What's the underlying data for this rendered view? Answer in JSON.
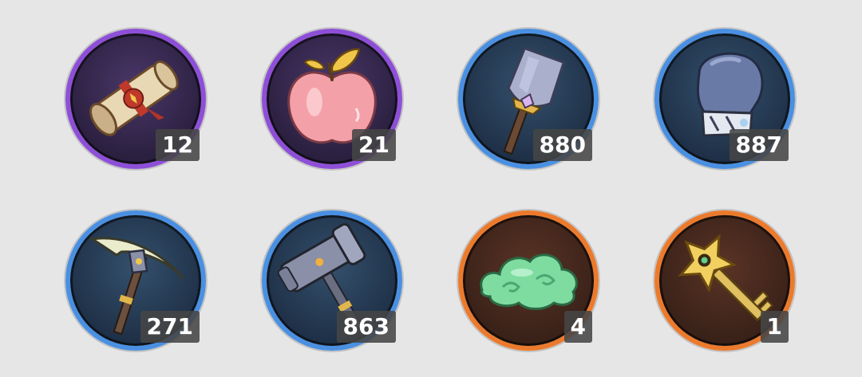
{
  "inventory": {
    "items": [
      {
        "icon": "scroll-icon",
        "rarity": "purple",
        "count": "12"
      },
      {
        "icon": "apple-icon",
        "rarity": "purple",
        "count": "21"
      },
      {
        "icon": "shovel-icon",
        "rarity": "blue",
        "count": "880"
      },
      {
        "icon": "gauntlet-icon",
        "rarity": "blue",
        "count": "887"
      },
      {
        "icon": "pickaxe-icon",
        "rarity": "blue",
        "count": "271"
      },
      {
        "icon": "hammer-icon",
        "rarity": "blue",
        "count": "863"
      },
      {
        "icon": "cloud-icon",
        "rarity": "orange",
        "count": "4"
      },
      {
        "icon": "key-icon",
        "rarity": "orange",
        "count": "1"
      }
    ]
  },
  "colors": {
    "purple": "#8e4fd8",
    "blue": "#4a90e2",
    "orange": "#ec7a2c",
    "badge": "#464646"
  }
}
